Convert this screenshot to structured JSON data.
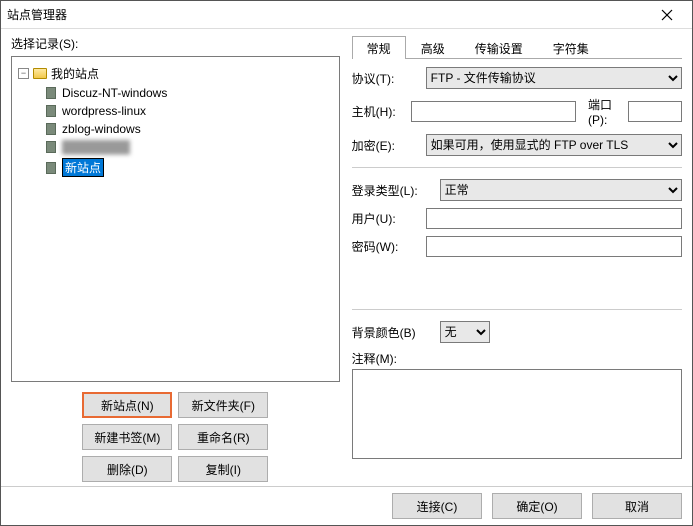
{
  "window": {
    "title": "站点管理器"
  },
  "left": {
    "select_label": "选择记录(S):",
    "root": "我的站点",
    "sites": [
      {
        "name": "Discuz-NT-windows"
      },
      {
        "name": "wordpress-linux"
      },
      {
        "name": "zblog-windows"
      },
      {
        "name": "████████",
        "blurred": true
      },
      {
        "name": "新站点",
        "editing": true
      }
    ],
    "buttons": {
      "new_site": "新站点(N)",
      "new_folder": "新文件夹(F)",
      "new_bookmark": "新建书签(M)",
      "rename": "重命名(R)",
      "delete": "删除(D)",
      "copy": "复制(I)"
    }
  },
  "tabs": {
    "general": "常规",
    "advanced": "高级",
    "transfer": "传输设置",
    "charset": "字符集"
  },
  "form": {
    "protocol_label": "协议(T):",
    "protocol_value": "FTP - 文件传输协议",
    "host_label": "主机(H):",
    "host_value": "",
    "port_label": "端口(P):",
    "port_value": "",
    "encryption_label": "加密(E):",
    "encryption_value": "如果可用，使用显式的 FTP over TLS",
    "logon_label": "登录类型(L):",
    "logon_value": "正常",
    "user_label": "用户(U):",
    "user_value": "",
    "pass_label": "密码(W):",
    "pass_value": "",
    "bgcolor_label": "背景颜色(B)",
    "bgcolor_value": "无",
    "comment_label": "注释(M):",
    "comment_value": ""
  },
  "footer": {
    "connect": "连接(C)",
    "ok": "确定(O)",
    "cancel": "取消"
  }
}
